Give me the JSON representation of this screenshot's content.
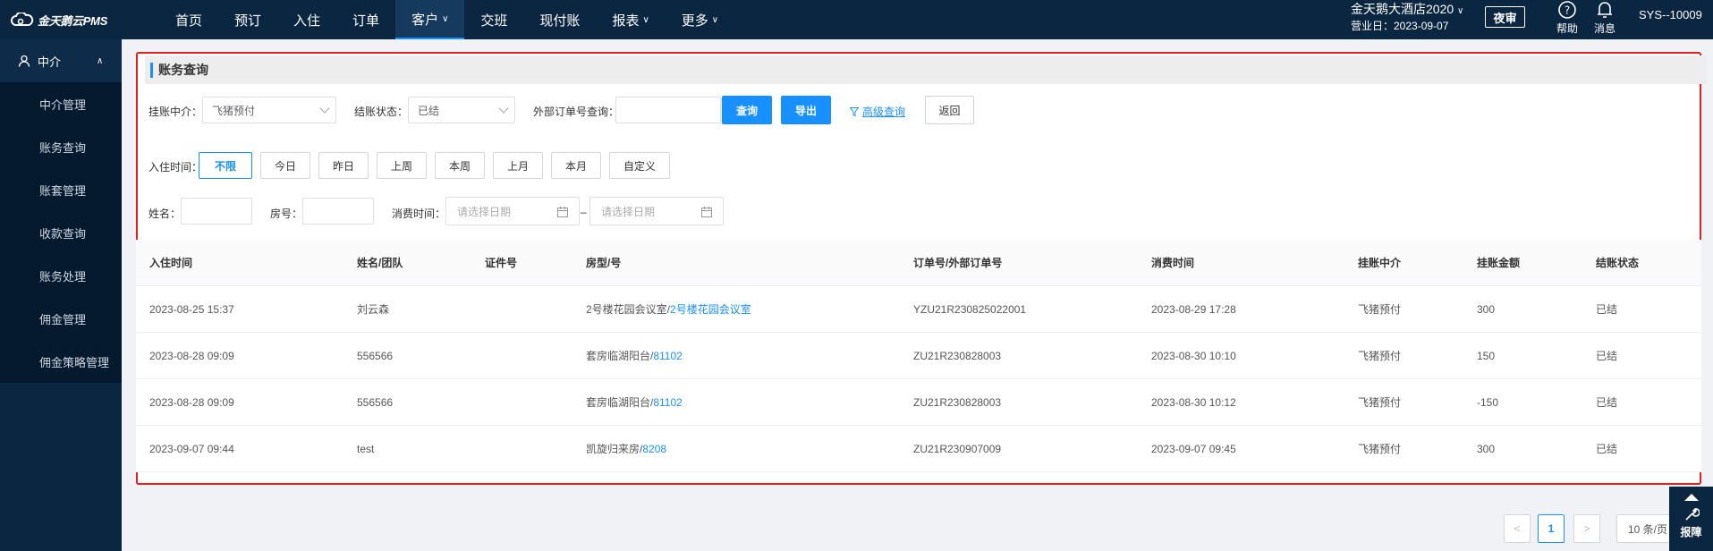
{
  "app": {
    "brand": "金天鹅云PMS",
    "nav": [
      {
        "label": "首页",
        "dropdown": false,
        "active": false
      },
      {
        "label": "预订",
        "dropdown": false,
        "active": false
      },
      {
        "label": "入住",
        "dropdown": false,
        "active": false
      },
      {
        "label": "订单",
        "dropdown": false,
        "active": false
      },
      {
        "label": "客户",
        "dropdown": true,
        "active": true
      },
      {
        "label": "交班",
        "dropdown": false,
        "active": false
      },
      {
        "label": "现付账",
        "dropdown": false,
        "active": false
      },
      {
        "label": "报表",
        "dropdown": true,
        "active": false
      },
      {
        "label": "更多",
        "dropdown": true,
        "active": false
      }
    ],
    "hotel_name": "金天鹅大酒店2020",
    "business_date": "营业日：2023-09-07",
    "night_audit": "夜审",
    "help": "帮助",
    "messages": "消息",
    "user": "SYS--10009",
    "colors": {
      "nav_bg": "#0b2640",
      "accent": "#1890ff",
      "highlight_border": "#e0211e"
    }
  },
  "sidebar": {
    "section": "中介",
    "items": [
      "中介管理",
      "账务查询",
      "账套管理",
      "收款查询",
      "账务处理",
      "佣金管理",
      "佣金策略管理"
    ]
  },
  "panel": {
    "title": "账务查询",
    "filters": {
      "agent_label": "挂账中介：",
      "agent_value": "飞猪预付",
      "status_label": "结账状态：",
      "status_value": "已结",
      "ext_order_label": "外部订单号查询：",
      "ext_order_value": "",
      "search": "查询",
      "export": "导出",
      "advanced": "高级查询",
      "back": "返回",
      "checkin_label": "入住时间：",
      "chips": [
        "不限",
        "今日",
        "昨日",
        "上周",
        "本周",
        "上月",
        "本月",
        "自定义"
      ],
      "name_label": "姓名：",
      "room_label": "房号：",
      "consume_label": "消费时间：",
      "date_placeholder": "请选择日期",
      "date_sep": "–"
    }
  },
  "table": {
    "headers": [
      "入住时间",
      "姓名/团队",
      "证件号",
      "房型/号",
      "订单号/外部订单号",
      "消费时间",
      "挂账中介",
      "挂账金额",
      "结账状态"
    ],
    "rows": [
      {
        "checkin": "2023-08-25 15:37",
        "name": "刘云森",
        "id": "",
        "room_type": "2号楼花园会议室/",
        "room_no": "2号楼花园会议室",
        "order": "YZU21R230825022001",
        "consume": "2023-08-29 17:28",
        "agent": "飞猪预付",
        "amount": "300",
        "status": "已结"
      },
      {
        "checkin": "2023-08-28 09:09",
        "name": "556566",
        "id": "",
        "room_type": "套房临湖阳台/",
        "room_no": "81102",
        "order": "ZU21R230828003",
        "consume": "2023-08-30 10:10",
        "agent": "飞猪预付",
        "amount": "150",
        "status": "已结"
      },
      {
        "checkin": "2023-08-28 09:09",
        "name": "556566",
        "id": "",
        "room_type": "套房临湖阳台/",
        "room_no": "81102",
        "order": "ZU21R230828003",
        "consume": "2023-08-30 10:12",
        "agent": "飞猪预付",
        "amount": "-150",
        "status": "已结"
      },
      {
        "checkin": "2023-09-07 09:44",
        "name": "test",
        "id": "",
        "room_type": "凯旋归来房/",
        "room_no": "8208",
        "order": "ZU21R230907009",
        "consume": "2023-09-07 09:45",
        "agent": "飞猪预付",
        "amount": "300",
        "status": "已结"
      }
    ]
  },
  "pagination": {
    "prev": "<",
    "current": "1",
    "next": ">",
    "page_size": "10 条/页"
  },
  "report_button": "报障"
}
